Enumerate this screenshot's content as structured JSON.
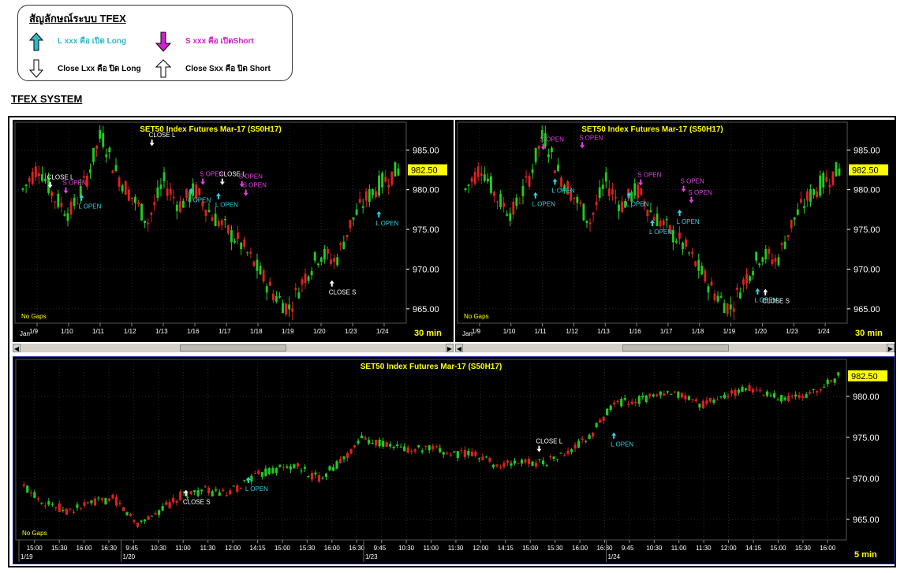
{
  "legend": {
    "title": "สัญลักษณ์ระบบ TFEX",
    "items": [
      {
        "text": "L xxx คือ เปิด Long",
        "color": "#2fb8c8",
        "icon": "cyan-up-arrow-icon"
      },
      {
        "text": "S xxx คือ เปิดShort",
        "color": "#cc22cc",
        "icon": "magenta-down-arrow-icon"
      },
      {
        "text": "Close Lxx คือ ปิด Long",
        "color": "#000000",
        "icon": "white-down-arrow-icon"
      },
      {
        "text": "Close Sxx คือ ปิด Short",
        "color": "#000000",
        "icon": "white-up-arrow-icon"
      }
    ]
  },
  "system_title": "TFEX SYSTEM",
  "charts": [
    {
      "title": "SET50  Index  Futures  Mar-17  (S50H17)",
      "timeframe": "30  min",
      "gap_label": "No  Gaps",
      "month_label": "Jan",
      "last_price": "982.50",
      "y_ticks": [
        "985.00",
        "980.00",
        "975.00",
        "970.00",
        "965.00"
      ],
      "x_ticks": [
        "1/9",
        "1/10",
        "1/11",
        "1/12",
        "1/13",
        "1/16",
        "1/17",
        "1/18",
        "1/19",
        "1/20",
        "1/23",
        "1/24"
      ],
      "annotations": [
        {
          "text": "CLOSE  L",
          "color": "#ffffff",
          "arrow": "down"
        },
        {
          "text": "CLOSE  L",
          "color": "#ffffff",
          "arrow": "down"
        },
        {
          "text": "S  OPEN",
          "color": "#e040e0",
          "arrow": "down"
        },
        {
          "text": "L  OPEN",
          "color": "#30d0e0",
          "arrow": "up"
        },
        {
          "text": "CLOSE  L",
          "color": "#ffffff",
          "arrow": "down"
        },
        {
          "text": "S  OPEN",
          "color": "#e040e0",
          "arrow": "down"
        },
        {
          "text": "L  OPEN",
          "color": "#30d0e0",
          "arrow": "up"
        },
        {
          "text": "S  OPEN",
          "color": "#e040e0",
          "arrow": "down"
        },
        {
          "text": "L  OPEN",
          "color": "#30d0e0",
          "arrow": "up"
        },
        {
          "text": "S  OPEN",
          "color": "#e040e0",
          "arrow": "down"
        },
        {
          "text": "CLOSE  S",
          "color": "#ffffff",
          "arrow": "up"
        },
        {
          "text": "L  OPEN",
          "color": "#30d0e0",
          "arrow": "up"
        }
      ]
    },
    {
      "title": "SET50  Index  Futures  Mar-17  (S50H17)",
      "timeframe": "30  min",
      "gap_label": "No  Gaps",
      "month_label": "Jan",
      "last_price": "982.50",
      "y_ticks": [
        "985.00",
        "980.00",
        "975.00",
        "970.00",
        "965.00"
      ],
      "x_ticks": [
        "1/9",
        "1/10",
        "1/11",
        "1/12",
        "1/13",
        "1/16",
        "1/17",
        "1/18",
        "1/19",
        "1/20",
        "1/23",
        "1/24"
      ],
      "annotations": [
        {
          "text": "S  OPEN",
          "color": "#e040e0",
          "arrow": "down"
        },
        {
          "text": "S  OPEN",
          "color": "#e040e0",
          "arrow": "down"
        },
        {
          "text": "L  OPEN",
          "color": "#30d0e0",
          "arrow": "up"
        },
        {
          "text": "L  OPEN",
          "color": "#30d0e0",
          "arrow": "up"
        },
        {
          "text": "S  OPEN",
          "color": "#e040e0",
          "arrow": "down"
        },
        {
          "text": "L  OPEN",
          "color": "#30d0e0",
          "arrow": "up"
        },
        {
          "text": "S  OPEN",
          "color": "#e040e0",
          "arrow": "down"
        },
        {
          "text": "L  OPEN",
          "color": "#30d0e0",
          "arrow": "up"
        },
        {
          "text": "S  OPEN",
          "color": "#e040e0",
          "arrow": "down"
        },
        {
          "text": "L  OPEN",
          "color": "#30d0e0",
          "arrow": "up"
        },
        {
          "text": "L  OPEN",
          "color": "#30d0e0",
          "arrow": "up"
        },
        {
          "text": "CLOSE  S",
          "color": "#ffffff",
          "arrow": "up"
        }
      ]
    },
    {
      "title": "SET50  Index  Futures  Mar-17  (S50H17)",
      "timeframe": "5  min",
      "gap_label": "No  Gaps",
      "last_price": "982.50",
      "y_ticks": [
        "980.00",
        "975.00",
        "970.00",
        "965.00"
      ],
      "x_ticks": [
        "15:00",
        "15:30",
        "16:00",
        "16:30",
        "9:45",
        "10:30",
        "11:00",
        "11:30",
        "12:00",
        "14:15",
        "15:00",
        "15:30",
        "16:00",
        "16:30",
        "9:45",
        "10:30",
        "11:00",
        "11:30",
        "12:00",
        "14:15",
        "15:00",
        "15:30",
        "16:00",
        "16:30",
        "9:45",
        "10:30",
        "11:00",
        "11:30",
        "12:00",
        "14:15",
        "15:00",
        "15:30",
        "16:00"
      ],
      "date_labels": [
        "1/19",
        "1/20",
        "1/23",
        "1/24"
      ],
      "annotations": [
        {
          "text": "CLOSE  S",
          "color": "#ffffff",
          "arrow": "up"
        },
        {
          "text": "L  OPEN",
          "color": "#30d0e0",
          "arrow": "up"
        },
        {
          "text": "CLOSE  L",
          "color": "#ffffff",
          "arrow": "down"
        },
        {
          "text": "L  OPEN",
          "color": "#30d0e0",
          "arrow": "up"
        }
      ]
    }
  ],
  "colors": {
    "up": "#22cc22",
    "down": "#dd2222",
    "title": "#ffff00",
    "axis": "#ffffff",
    "grid": "#333333",
    "price_badge": "#ffff00"
  }
}
